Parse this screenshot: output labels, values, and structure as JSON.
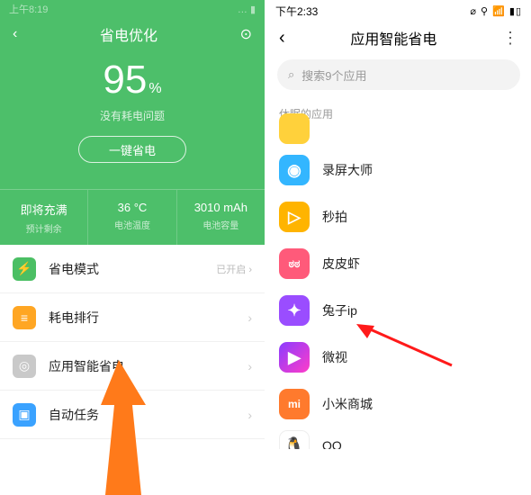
{
  "left": {
    "status_time": "上午8:19",
    "header_title": "省电优化",
    "percent_value": "95",
    "percent_unit": "%",
    "subtext": "没有耗电问题",
    "onekey_label": "一键省电",
    "stats": [
      {
        "value": "即将充满",
        "label": "预计剩余"
      },
      {
        "value": "36 °C",
        "label": "电池温度"
      },
      {
        "value": "3010 mAh",
        "label": "电池容量"
      }
    ],
    "items": [
      {
        "icon": "⚡",
        "color": "bg-green",
        "label": "省电模式",
        "right": "已开启 ›"
      },
      {
        "icon": "≡",
        "color": "bg-orange",
        "label": "耗电排行",
        "right": "›"
      },
      {
        "icon": "◎",
        "color": "bg-gray",
        "label": "应用智能省电",
        "right": "›"
      },
      {
        "icon": "▣",
        "color": "bg-blue",
        "label": "自动任务",
        "right": "›"
      }
    ]
  },
  "right": {
    "status_time": "下午2:33",
    "status_icons": "⌀ ⚲ 📶 ▮▯",
    "header_title": "应用智能省电",
    "search_placeholder": "搜索9个应用",
    "section_label": "休眠的应用",
    "apps": [
      {
        "label": "",
        "color": "bg-yellow"
      },
      {
        "label": "录屏大师",
        "color": "bg-cyan",
        "glyph": "◉"
      },
      {
        "label": "秒拍",
        "color": "bg-gold",
        "glyph": "▷"
      },
      {
        "label": "皮皮虾",
        "color": "bg-pink",
        "glyph": "ಠಠ"
      },
      {
        "label": "兔子ip",
        "color": "bg-purple",
        "glyph": "✦"
      },
      {
        "label": "微视",
        "color": "bg-grad",
        "glyph": "▶"
      },
      {
        "label": "小米商城",
        "color": "bg-miorg",
        "glyph": "mi"
      },
      {
        "label": "QQ",
        "color": "",
        "glyph": "🐧"
      }
    ]
  }
}
